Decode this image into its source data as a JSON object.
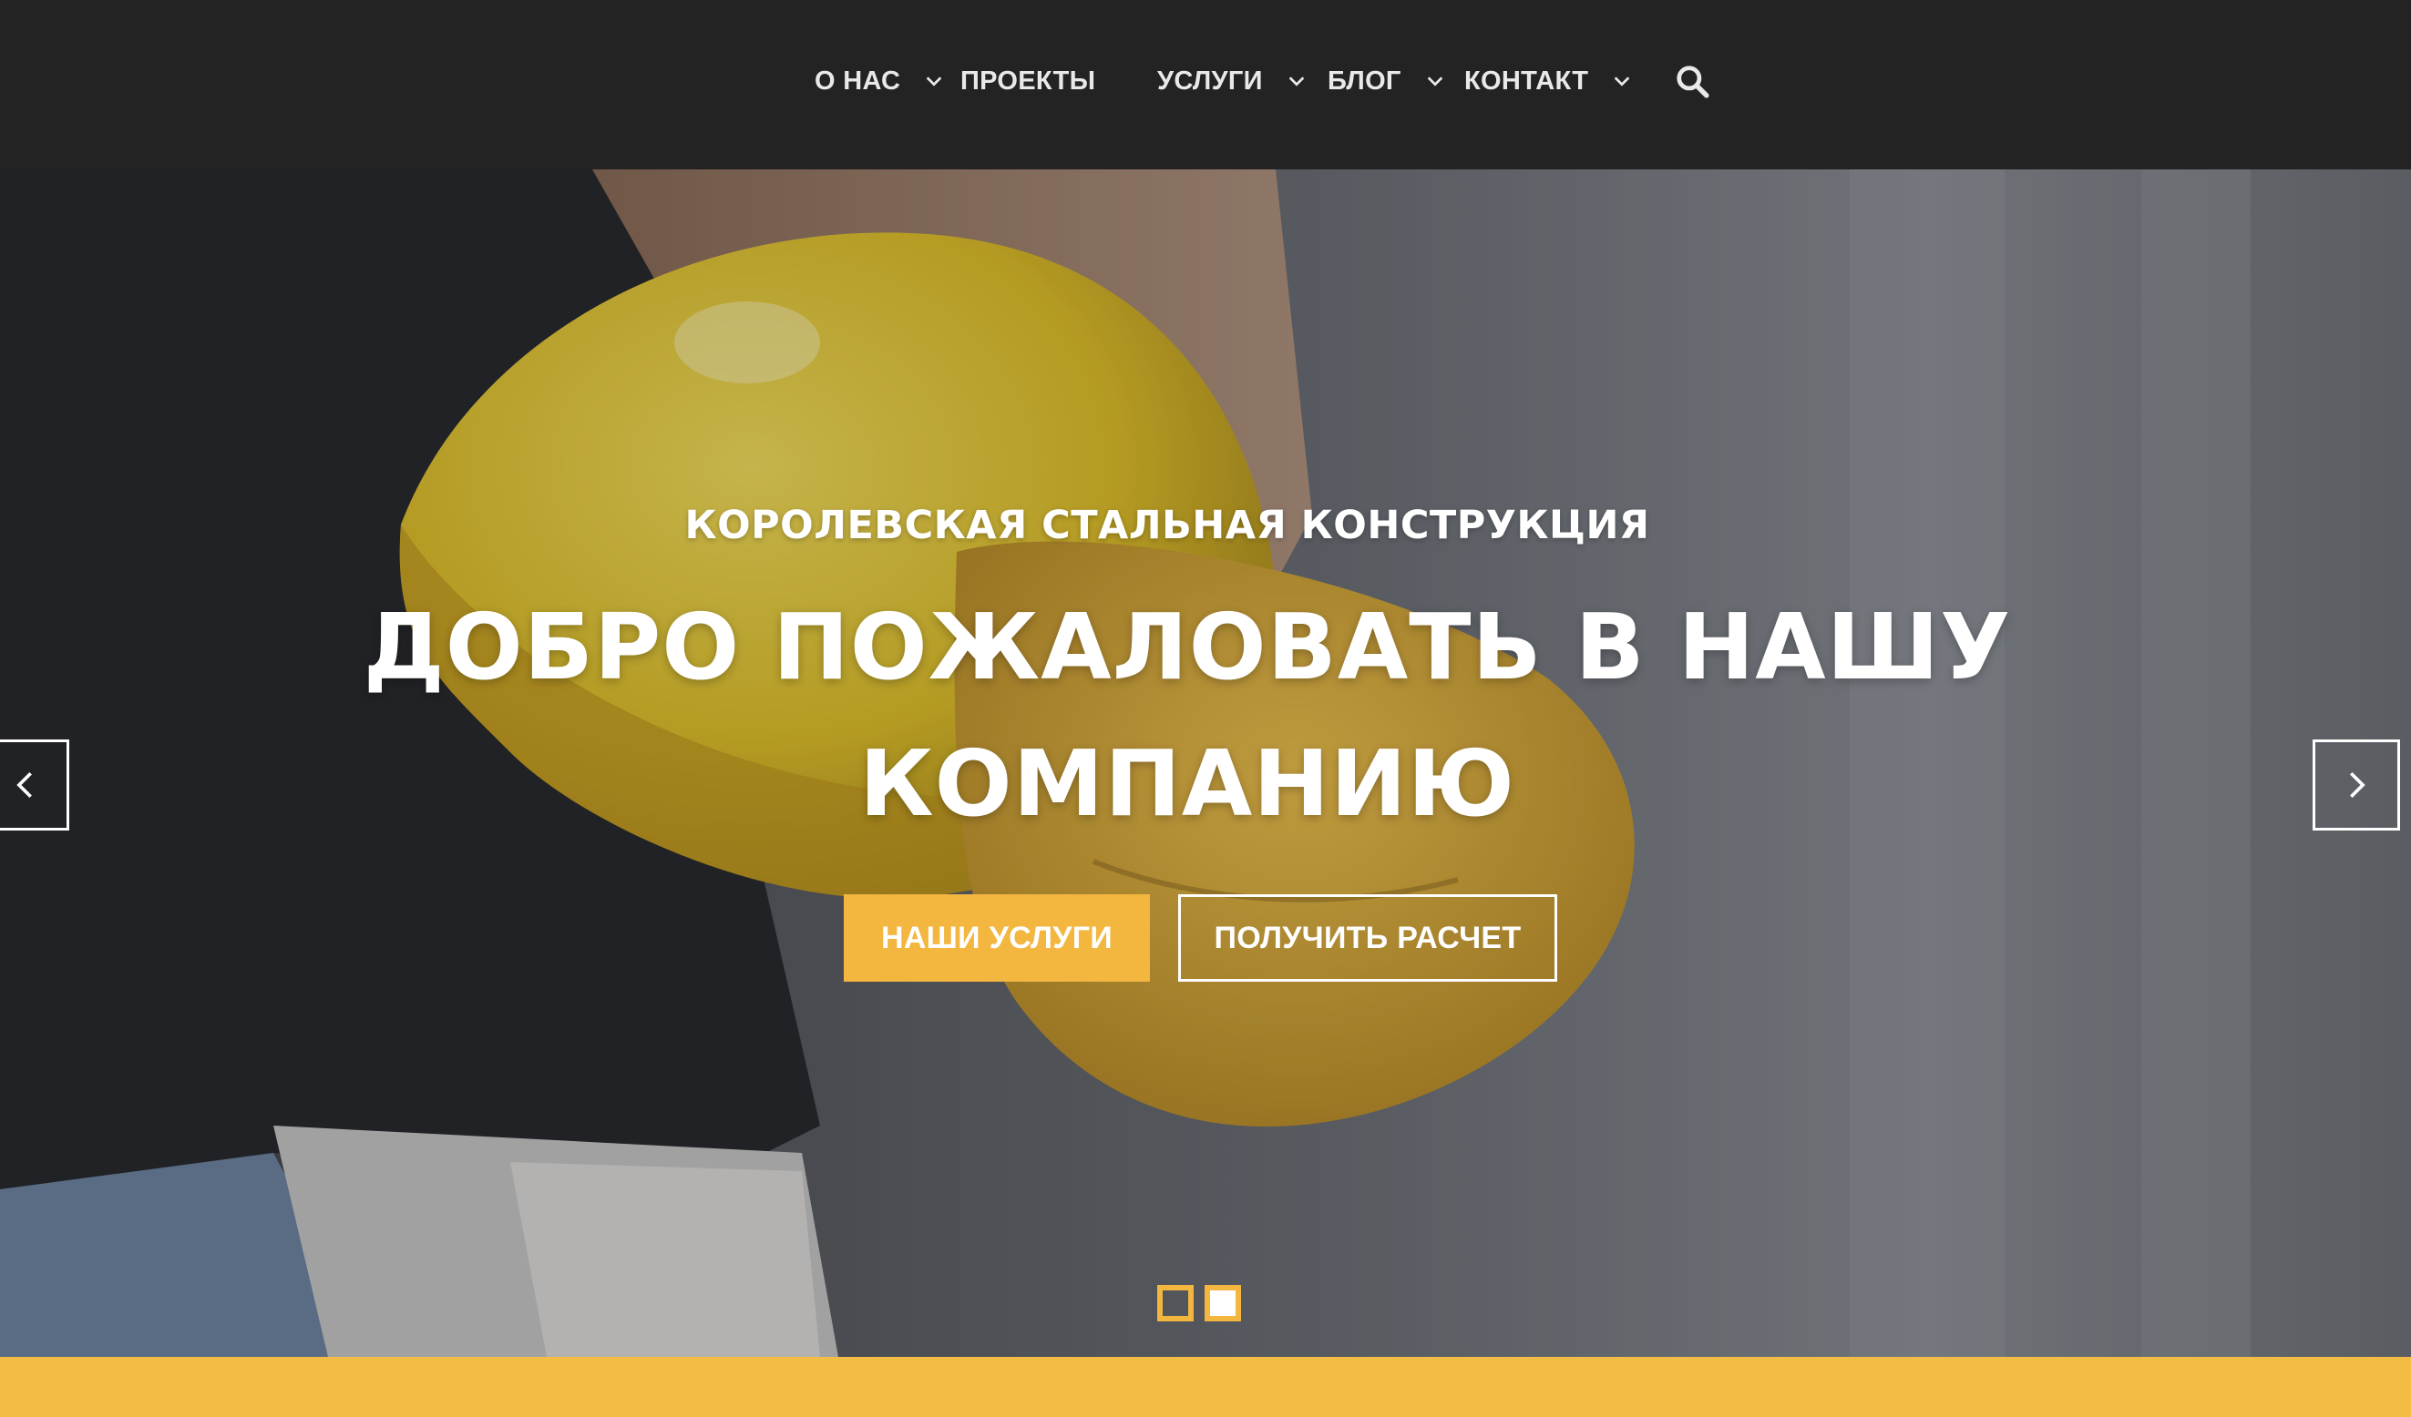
{
  "nav": {
    "items": [
      {
        "label": "О НАС",
        "has_dropdown": true
      },
      {
        "label": "ПРОЕКТЫ",
        "has_dropdown": false
      },
      {
        "label": "УСЛУГИ",
        "has_dropdown": true
      },
      {
        "label": "БЛОГ",
        "has_dropdown": true
      },
      {
        "label": "КОНТАКТ",
        "has_dropdown": true
      }
    ],
    "search_icon": "search-icon"
  },
  "hero": {
    "subtitle": "КОРОЛЕВСКАЯ СТАЛЬНАЯ КОНСТРУКЦИЯ",
    "headline": "ДОБРО ПОЖАЛОВАТЬ В НАШУ КОМПАНИЮ",
    "primary_button": "НАШИ УСЛУГИ",
    "secondary_button": "ПОЛУЧИТЬ РАСЧЕТ",
    "prev_icon": "chevron-left-icon",
    "next_icon": "chevron-right-icon",
    "slides": {
      "total": 2,
      "active": 2
    }
  },
  "colors": {
    "nav_bg": "#232324",
    "nav_text": "#e9e9e9",
    "accent": "#f3b63f",
    "bottom_strip": "#f3bd45",
    "hero_text": "#ffffff"
  }
}
